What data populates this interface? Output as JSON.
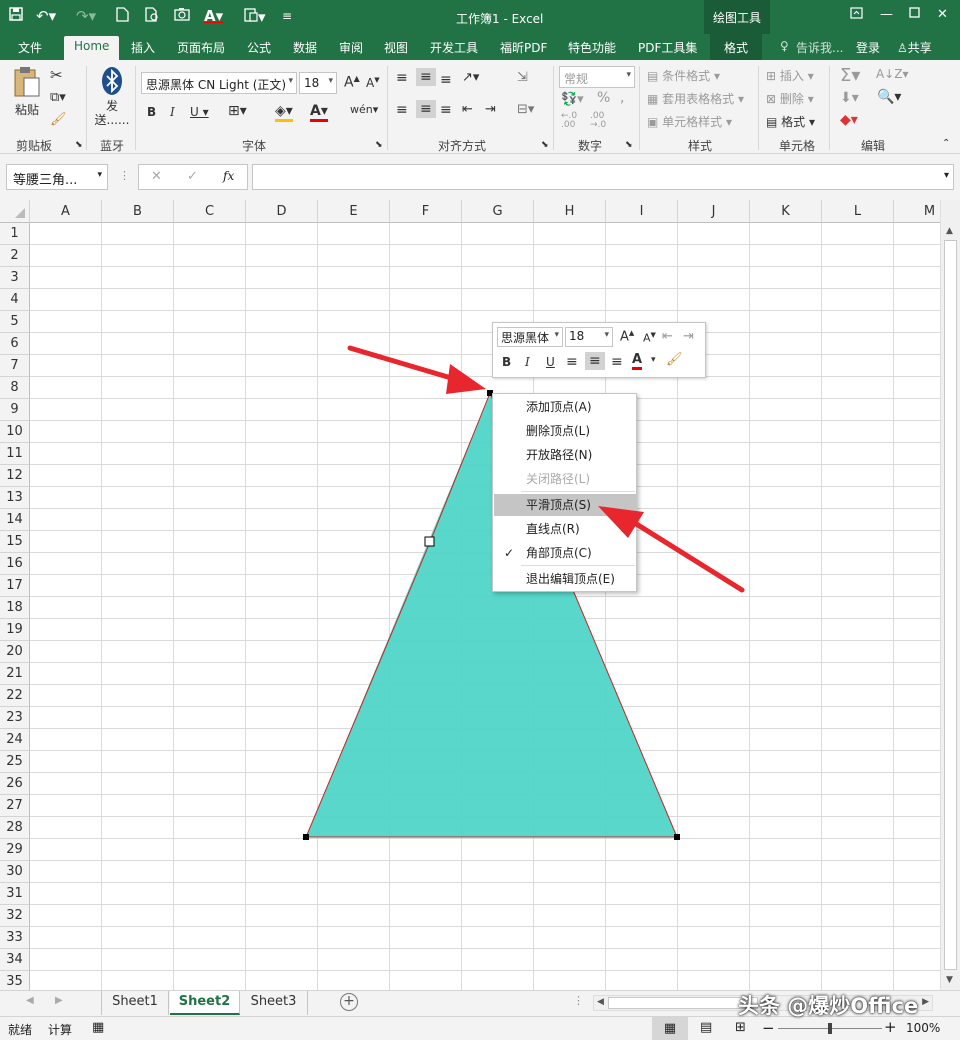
{
  "window": {
    "title": "工作簿1 - Excel",
    "contextual_tab_group": "绘图工具"
  },
  "tabs": [
    "文件",
    "Home",
    "插入",
    "页面布局",
    "公式",
    "数据",
    "审阅",
    "视图",
    "开发工具",
    "福昕PDF",
    "特色功能",
    "PDF工具集",
    "格式"
  ],
  "tell_me": "告诉我...",
  "signin": "登录",
  "share": "共享",
  "ribbon": {
    "clipboard": {
      "paste": "粘贴",
      "label": "剪贴板"
    },
    "bluetooth": {
      "send": "发送......",
      "label": "蓝牙"
    },
    "font": {
      "name": "思源黑体 CN Light (正文)",
      "size": "18",
      "label": "字体"
    },
    "alignment": {
      "label": "对齐方式"
    },
    "number": {
      "format": "常规",
      "label": "数字"
    },
    "styles": {
      "conditional": "条件格式",
      "table": "套用表格格式",
      "cell": "单元格样式",
      "label": "样式"
    },
    "cells": {
      "insert": "插入",
      "delete": "删除",
      "format": "格式",
      "label": "单元格"
    },
    "editing": {
      "label": "编辑"
    }
  },
  "formula_bar": {
    "name_box": "等腰三角...",
    "fx": "fx",
    "content": ""
  },
  "columns": [
    "A",
    "B",
    "C",
    "D",
    "E",
    "F",
    "G",
    "H",
    "I",
    "J",
    "K",
    "L",
    "M"
  ],
  "rows": [
    "1",
    "2",
    "3",
    "4",
    "5",
    "6",
    "7",
    "8",
    "9",
    "10",
    "11",
    "12",
    "13",
    "14",
    "15",
    "16",
    "17",
    "18",
    "19",
    "20",
    "21",
    "22",
    "23",
    "24",
    "25",
    "26",
    "27",
    "28",
    "29",
    "30",
    "31",
    "32",
    "33",
    "34",
    "35"
  ],
  "mini_toolbar": {
    "font": "思源黑体",
    "size": "18"
  },
  "context_menu": [
    {
      "label": "添加顶点(A)",
      "state": "normal"
    },
    {
      "label": "删除顶点(L)",
      "state": "normal"
    },
    {
      "label": "开放路径(N)",
      "state": "normal"
    },
    {
      "label": "关闭路径(L)",
      "state": "disabled"
    },
    {
      "label": "平滑顶点(S)",
      "state": "highlighted"
    },
    {
      "label": "直线点(R)",
      "state": "normal"
    },
    {
      "label": "角部顶点(C)",
      "state": "checked"
    },
    {
      "label": "退出编辑顶点(E)",
      "state": "normal"
    }
  ],
  "sheets": [
    "Sheet1",
    "Sheet2",
    "Sheet3"
  ],
  "active_sheet": "Sheet2",
  "status": {
    "ready": "就绪",
    "calc": "计算",
    "zoom": "100%"
  },
  "watermark": "头条 @爆炒Office",
  "colors": {
    "excel_green": "#217346",
    "shape_fill": "#4fd5c7",
    "arrow_red": "#e8262e"
  }
}
